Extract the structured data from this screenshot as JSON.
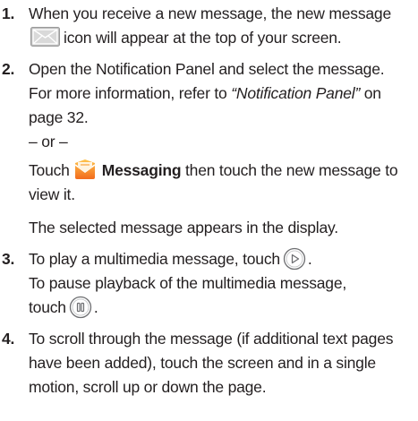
{
  "steps": [
    {
      "number": "1.",
      "line1": "When you receive a new message, the new message",
      "line2_after_icon": "icon will appear at the top of your screen."
    },
    {
      "number": "2.",
      "line1": "Open the Notification Panel and select the message.",
      "line2_a": "For more information, refer to ",
      "line2_ref": "“Notification Panel”",
      "line2_b": " on",
      "line3": "page 32.",
      "or": "– or –",
      "touch_word": "Touch",
      "messaging_label": "Messaging",
      "touch_rest": " then touch the new message to",
      "touch_end": "view it.",
      "result": "The selected message appears in the display."
    },
    {
      "number": "3.",
      "line1": "To play a multimedia message, touch",
      "line1_end": ".",
      "line2": "To pause playback of the multimedia message,",
      "line3": "touch",
      "line3_end": "."
    },
    {
      "number": "4.",
      "line1": "To scroll through the message (if additional text pages",
      "line2": "have been added), touch the screen and in a single",
      "line3": "motion, scroll up or down the page."
    }
  ],
  "icons": {
    "envelope": "new-message-envelope-icon",
    "messaging": "messaging-app-icon",
    "play": "play-icon",
    "pause": "pause-icon"
  },
  "colors": {
    "text": "#231f20",
    "step_number": "#231f20",
    "envelope_bg": "#c8c8c8",
    "messaging_orange": "#f7941d"
  }
}
